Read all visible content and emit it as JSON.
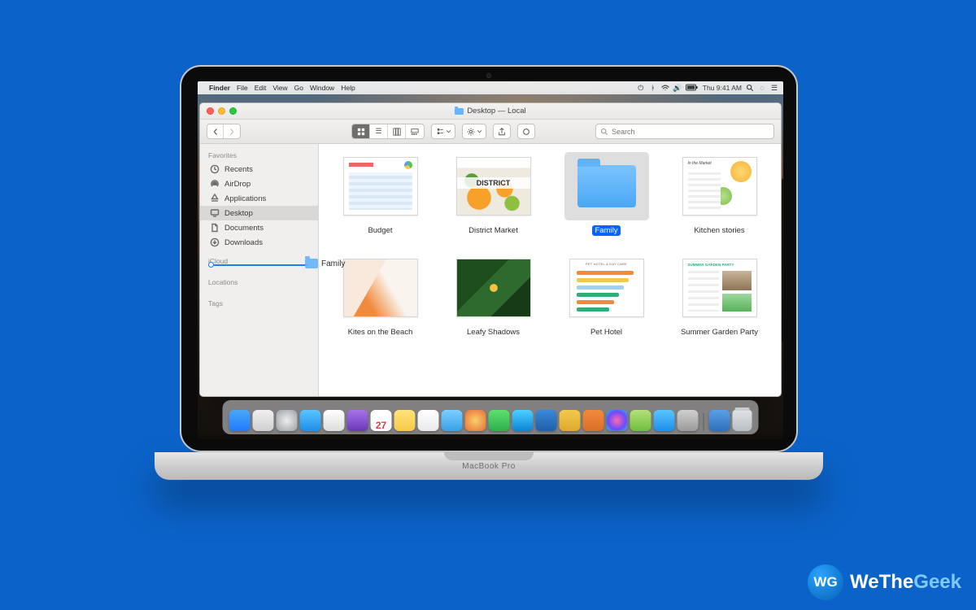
{
  "menubar": {
    "app": "Finder",
    "items": [
      "File",
      "Edit",
      "View",
      "Go",
      "Window",
      "Help"
    ],
    "clock": "Thu 9:41 AM"
  },
  "window": {
    "title_prefix": "Desktop",
    "title_suffix": "— Local",
    "search_placeholder": "Search"
  },
  "sidebar": {
    "sections": [
      "Favorites",
      "iCloud",
      "Locations",
      "Tags"
    ],
    "favorites": [
      {
        "label": "Recents",
        "icon": "clock"
      },
      {
        "label": "AirDrop",
        "icon": "airdrop"
      },
      {
        "label": "Applications",
        "icon": "apps"
      },
      {
        "label": "Desktop",
        "icon": "desktop",
        "selected": true
      },
      {
        "label": "Documents",
        "icon": "doc"
      },
      {
        "label": "Downloads",
        "icon": "download"
      }
    ]
  },
  "drag": {
    "label": "Family"
  },
  "files": [
    {
      "label": "Budget",
      "kind": "sheet"
    },
    {
      "label": "District Market",
      "kind": "image"
    },
    {
      "label": "Family",
      "kind": "folder",
      "selected": true
    },
    {
      "label": "Kitchen stories",
      "kind": "doc"
    },
    {
      "label": "Kites on the Beach",
      "kind": "image"
    },
    {
      "label": "Leafy Shadows",
      "kind": "image"
    },
    {
      "label": "Pet Hotel",
      "kind": "sheet"
    },
    {
      "label": "Summer Garden Party",
      "kind": "doc"
    }
  ],
  "pethotel_bars": [
    "#f08a3c",
    "#f2c94c",
    "#9fd0f5",
    "#2fae7a",
    "#f08a3c",
    "#2fae7a"
  ],
  "laptop_brand": "MacBook Pro",
  "watermark": {
    "brand_a": "WeThe",
    "brand_b": "Geek",
    "mono": "WG"
  }
}
